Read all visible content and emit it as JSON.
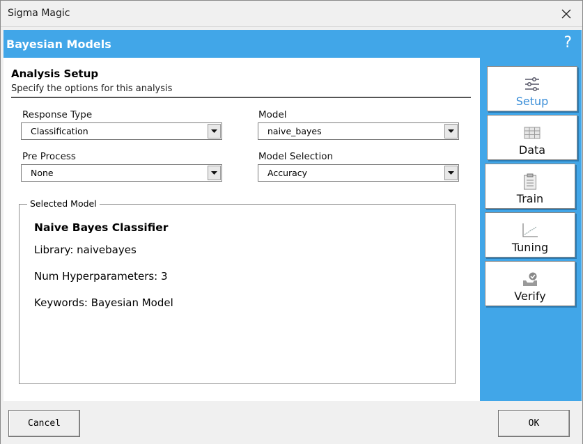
{
  "window": {
    "title": "Sigma Magic"
  },
  "banner": {
    "title": "Bayesian Models",
    "help": "?"
  },
  "section": {
    "title": "Analysis Setup",
    "subtitle": "Specify the options for this analysis"
  },
  "fields": {
    "response_type": {
      "label": "Response Type",
      "value": "Classification"
    },
    "model": {
      "label": "Model",
      "value": "naive_bayes"
    },
    "pre_process": {
      "label": "Pre Process",
      "value": "None"
    },
    "model_selection": {
      "label": "Model Selection",
      "value": "Accuracy"
    }
  },
  "selected_model": {
    "legend": "Selected Model",
    "name": "Naive Bayes Classifier",
    "library": "Library: naivebayes",
    "hyperparameters": "Num Hyperparameters: 3",
    "keywords": "Keywords: Bayesian Model"
  },
  "nav": [
    {
      "label": "Setup",
      "icon": "sliders-icon",
      "active": true
    },
    {
      "label": "Data",
      "icon": "table-icon"
    },
    {
      "label": "Train",
      "icon": "clipboard-icon"
    },
    {
      "label": "Tuning",
      "icon": "line-chart-icon"
    },
    {
      "label": "Verify",
      "icon": "check-badge-icon"
    }
  ],
  "footer": {
    "cancel_label": "Cancel",
    "ok_label": "OK"
  },
  "colors": {
    "accent": "#41a6e8",
    "active_label": "#3a8ed8"
  }
}
